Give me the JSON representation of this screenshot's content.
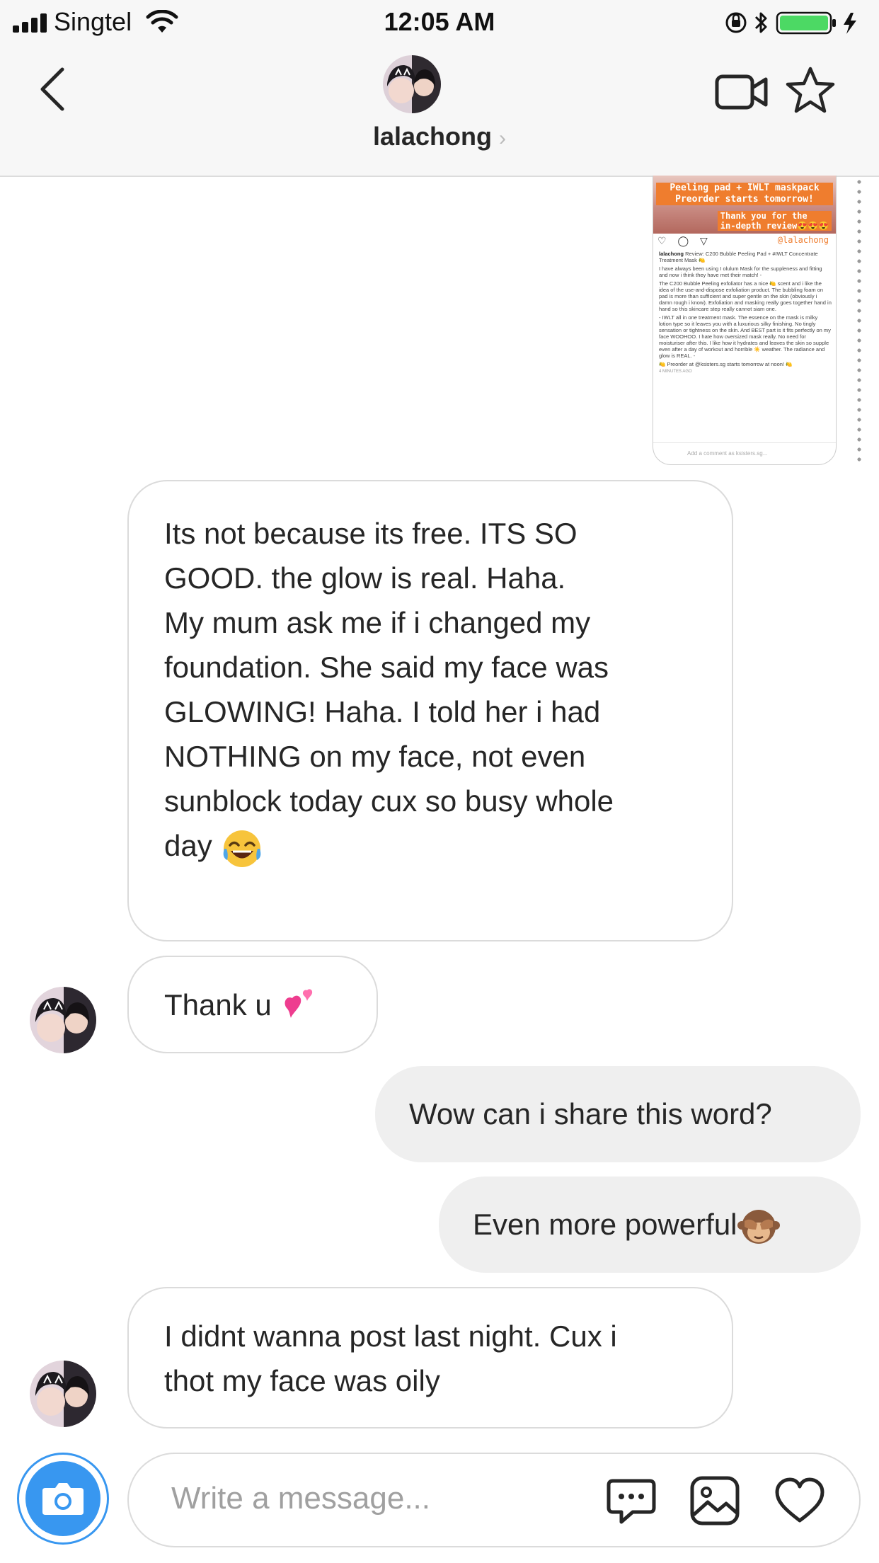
{
  "status_bar": {
    "carrier": "Singtel",
    "time": "12:05 AM"
  },
  "header": {
    "username": "lalachong",
    "chevron": "›",
    "icons": [
      "back-icon",
      "video-call-icon",
      "star-icon"
    ]
  },
  "shared_post": {
    "overlay_line1": "Peeling pad + IWLT maskpack",
    "overlay_line2": "Preorder starts tomorrow!",
    "overlay_line3": "Thank you for the",
    "overlay_line4": "in-depth review😍😍😍",
    "tag": "@lalachong",
    "caption_head": "lalachong",
    "caption_title": "Review: C200 Bubble Peeling Pad + #IWLT Concentrate Treatment Mask 🍋",
    "caption_body1": "I have always been using I olulum Mask for the suppleness and fitting and now i think they have met their match! -",
    "caption_body2": "The C200 Bubble Peeling exfoliator has a nice 🍋 scent and i like the idea of the use-and-dispose exfoliation product. The bubbling foam on pad is more than sufficient and super gentle on the skin (obviously i damn rough i know). Exfoliation and masking really goes together hand in hand so this skincare step really cannot siam one.",
    "caption_body3": "- IWLT all in one treatment mask. The essence on the mask is milky lotion type so it leaves you with a luxurious silky finishing. No tingly sensation or tightness on the skin. And BEST part is it fits perfectly on my face WOOHOO. I hate how oversized mask really. No need for moisturiser after this. I like how it hydrates and leaves the skin so supple even after a day of workout and horrible ☀️ weather. The radiance and glow is REAL. -",
    "caption_preorder": "🍋 Preorder at @ksisters.sg starts tomorrow at noon! 🍋",
    "timestamp": "4 MINUTES AGO",
    "comment_placeholder": "Add a comment as ksisters.sg..."
  },
  "messages": [
    {
      "from": "them",
      "lines": [
        "Its not because its free. ITS SO",
        "GOOD. the glow is real. Haha.",
        "",
        "My mum ask me if i changed my",
        "foundation. She said my face was",
        "GLOWING! Haha. I told her i had",
        "NOTHING on my face, not even",
        "sunblock today cux so busy whole",
        "day"
      ],
      "emoji": "face-with-tears-of-joy"
    },
    {
      "from": "them",
      "text": "Thank u",
      "emoji": "two-hearts"
    },
    {
      "from": "me",
      "text": "Wow can i share this word?"
    },
    {
      "from": "me",
      "text": "Even more powerful",
      "emoji": "see-no-evil-monkey"
    },
    {
      "from": "them",
      "lines": [
        "I didnt wanna post last night. Cux i",
        "thot my face was oily"
      ]
    }
  ],
  "composer": {
    "placeholder": "Write a message...",
    "icons": [
      "camera-icon",
      "chat-bubble-icon",
      "image-icon",
      "heart-icon"
    ]
  },
  "colors": {
    "accent_blue": "#3897f0",
    "outgoing_bubble": "#efefef",
    "incoming_border": "#dbdbdb",
    "battery_green": "#4cd964",
    "overlay_orange": "#ef7d2e"
  }
}
